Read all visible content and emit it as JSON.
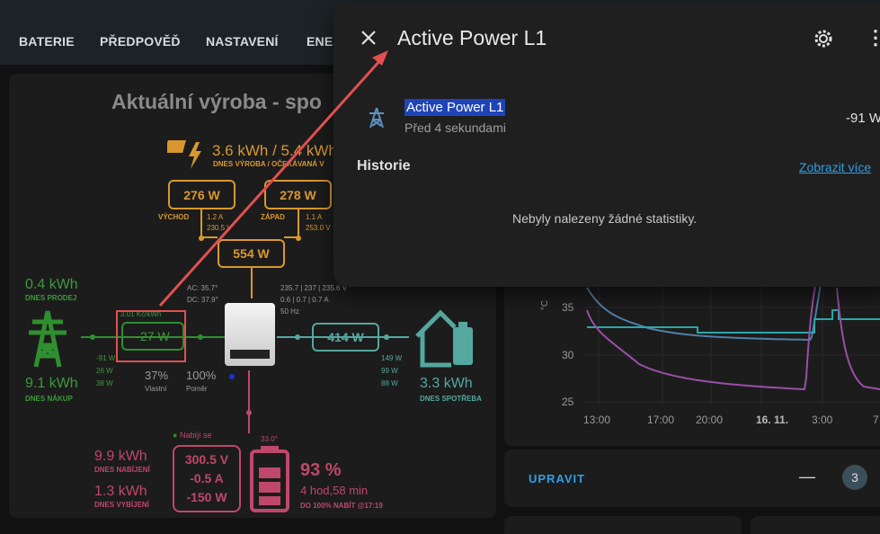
{
  "tabs": [
    "BATERIE",
    "PŘEDPOVĚĎ",
    "NASTAVENÍ",
    "ENE"
  ],
  "card": {
    "title": "Aktuální výroba - spo",
    "solar_today": "3.6 kWh / 5.4 kWh",
    "solar_today_label": "DNES VÝROBA / OČEKÁVANÁ V",
    "east": {
      "power": "276 W",
      "label": "VÝCHOD",
      "current": "1.2 A",
      "voltage": "230.5 V"
    },
    "west": {
      "power": "278 W",
      "label": "ZÁPAD",
      "current": "1.1 A",
      "voltage": "253.0 V"
    },
    "pv_total": "554 W",
    "grid": {
      "sold": "0.4 kWh",
      "sold_label": "DNES PRODEJ",
      "bought": "9.1 kWh",
      "bought_label": "DNES NÁKUP",
      "power": "-27 W",
      "price": "3.01 Kč/kWh",
      "phases": [
        "-91 W",
        "26 W",
        "38 W"
      ]
    },
    "self_pct": "37%",
    "self_label": "Vlastní",
    "ratio_pct": "100%",
    "ratio_label": "Poměr",
    "inverter": {
      "ac_temp": "AC: 35.7°",
      "dc_temp": "DC: 37.9°",
      "voltages": "235.7 | 237 | 235.6 V",
      "currents": "0.6 | 0.7 | 0.7 A",
      "freq": "50 Hz"
    },
    "home": {
      "power": "414 W",
      "phases": [
        "149 W",
        "99 W",
        "88 W"
      ],
      "consumption": "3.3 kWh",
      "consumption_label": "DNES SPOTŘEBA"
    },
    "battery": {
      "status": "Nabíjí se",
      "temp": "33.0°",
      "charged": "9.9 kWh",
      "charged_label": "DNES NABÍJENÍ",
      "discharged": "1.3 kWh",
      "discharged_label": "DNES VYBÍJENÍ",
      "voltage": "300.5 V",
      "current": "-0.5 A",
      "power": "-150 W",
      "soc": "93 %",
      "remaining": "4 hod,58 min",
      "full_at": "DO 100% NABÍT @17:19"
    }
  },
  "graph": {
    "unit": "°C",
    "y_ticks": [
      "35",
      "30",
      "25"
    ],
    "x_ticks": [
      "13:00",
      "17:00",
      "20:00",
      "16. 11.",
      "3:00",
      "7"
    ],
    "series_colors": [
      "#4f7fa8",
      "#2aa8a8",
      "#9b4fa8"
    ]
  },
  "footer": {
    "edit_label": "UPRAVIT",
    "count": "3",
    "minus": "—"
  },
  "dialog": {
    "title": "Active Power L1",
    "entity_name": "Active Power L1",
    "entity_time": "Před 4 sekundami",
    "entity_value": "-91 W",
    "history_label": "Historie",
    "show_more": "Zobrazit více",
    "no_stats": "Nebyly nalezeny žádné statistiky."
  },
  "colors": {
    "accent": "#2f9fe6",
    "highlight_box": "#e05050",
    "grid_green": "#2f8f2f",
    "battery_pink": "#c0476c",
    "solar_orange": "#d9982f"
  }
}
